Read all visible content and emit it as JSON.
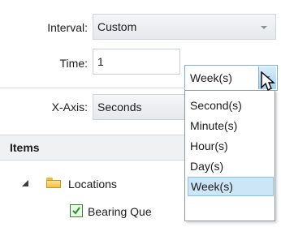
{
  "form": {
    "interval_label": "Interval:",
    "interval_value": "Custom",
    "time_label": "Time:",
    "time_value": "1",
    "time_unit_value": "Week(s)",
    "xaxis_label": "X-Axis:",
    "xaxis_value": "Seconds"
  },
  "items": {
    "header": "Items",
    "tree": [
      {
        "label": "Locations",
        "icon": "folder-icon",
        "expanded": true
      },
      {
        "label": "Bearing Que",
        "checked": true
      }
    ]
  },
  "unit_dropdown": {
    "options": [
      "Second(s)",
      "Minute(s)",
      "Hour(s)",
      "Day(s)",
      "Week(s)"
    ],
    "selected": "Week(s)"
  },
  "colors": {
    "selection_bg": "#cde6f7",
    "selection_border": "#89c2e8",
    "folder": "#f2c04b",
    "checkbox_check": "#2e8b2e"
  }
}
